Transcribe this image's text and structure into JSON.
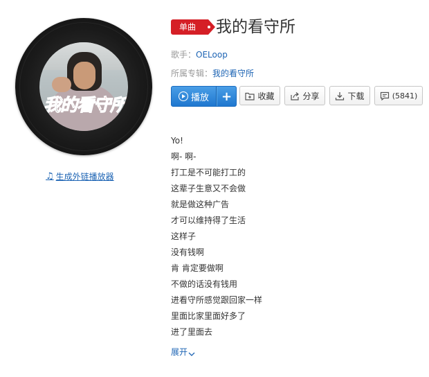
{
  "cover": {
    "art_text_black": "我的",
    "art_text_red": "看守所"
  },
  "ext_player_link": "生成外链播放器",
  "song": {
    "badge": "单曲",
    "title": "我的看守所",
    "singer_label": "歌手：",
    "singer": "OELoop",
    "album_label": "所属专辑：",
    "album": "我的看守所"
  },
  "buttons": {
    "play": "播放",
    "add": "+",
    "collect": "收藏",
    "share": "分享",
    "download": "下载",
    "comment_count": "(5841)"
  },
  "lyrics": [
    "Yo!",
    "啊- 啊-",
    "打工是不可能打工的",
    "这辈子生意又不会做",
    "就是做这种广告",
    "才可以维持得了生活",
    "这样子",
    "没有钱啊",
    "肯 肯定要做啊",
    "不做的话没有钱用",
    "进看守所感觉跟回家一样",
    "里面比家里面好多了",
    "进了里面去"
  ],
  "expand_label": "展开",
  "colors": {
    "accent_blue": "#1d64b4",
    "badge_red": "#d51f26",
    "play_blue": "#2a84d8"
  },
  "icons": {
    "ext_link": "music-note-icon",
    "play": "play-circle-icon",
    "collect": "add-folder-icon",
    "share": "share-icon",
    "download": "download-icon",
    "comment": "comment-icon",
    "expand": "chevron-down-icon"
  }
}
